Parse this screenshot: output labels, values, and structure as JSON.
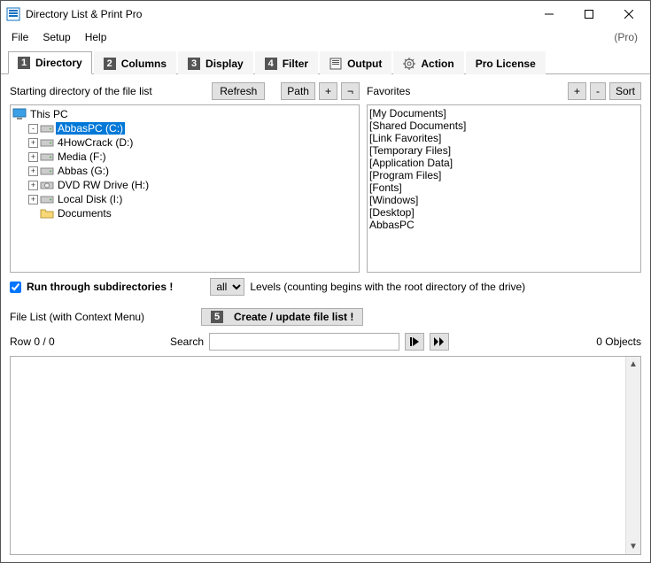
{
  "title": "Directory List & Print Pro",
  "edition": "(Pro)",
  "menu": {
    "file": "File",
    "setup": "Setup",
    "help": "Help"
  },
  "tabs": {
    "t1": "Directory",
    "t2": "Columns",
    "t3": "Display",
    "t4": "Filter",
    "t5": "Output",
    "t6": "Action",
    "t7": "Pro License"
  },
  "labels": {
    "starting": "Starting directory of the file list",
    "refresh": "Refresh",
    "path": "Path",
    "plus": "+",
    "neg": "¬",
    "favorites": "Favorites",
    "minus": "-",
    "sort": "Sort",
    "runsub": "Run through subdirectories !",
    "levels": "Levels  (counting begins with the root directory of the drive)",
    "all": "all",
    "filelist": "File List (with Context Menu)",
    "create": "Create / update file list !",
    "row": "Row 0 / 0",
    "search": "Search",
    "objects": "0 Objects"
  },
  "tree": [
    {
      "indent": 0,
      "exp": "",
      "icon": "pc",
      "label": "This PC",
      "sel": false
    },
    {
      "indent": 1,
      "exp": "-",
      "icon": "drive",
      "label": "AbbasPC (C:)",
      "sel": true
    },
    {
      "indent": 1,
      "exp": "+",
      "icon": "drive",
      "label": "4HowCrack (D:)",
      "sel": false
    },
    {
      "indent": 1,
      "exp": "+",
      "icon": "drive",
      "label": "Media (F:)",
      "sel": false
    },
    {
      "indent": 1,
      "exp": "+",
      "icon": "drive",
      "label": "Abbas (G:)",
      "sel": false
    },
    {
      "indent": 1,
      "exp": "+",
      "icon": "disc",
      "label": "DVD RW Drive (H:)",
      "sel": false
    },
    {
      "indent": 1,
      "exp": "+",
      "icon": "drive",
      "label": "Local Disk (I:)",
      "sel": false
    },
    {
      "indent": 1,
      "exp": "",
      "icon": "folder",
      "label": "Documents",
      "sel": false
    }
  ],
  "favs": [
    "[My Documents]",
    "[Shared Documents]",
    "[Link Favorites]",
    "[Temporary Files]",
    "[Application Data]",
    "[Program Files]",
    "[Fonts]",
    "[Windows]",
    "[Desktop]",
    "AbbasPC"
  ]
}
